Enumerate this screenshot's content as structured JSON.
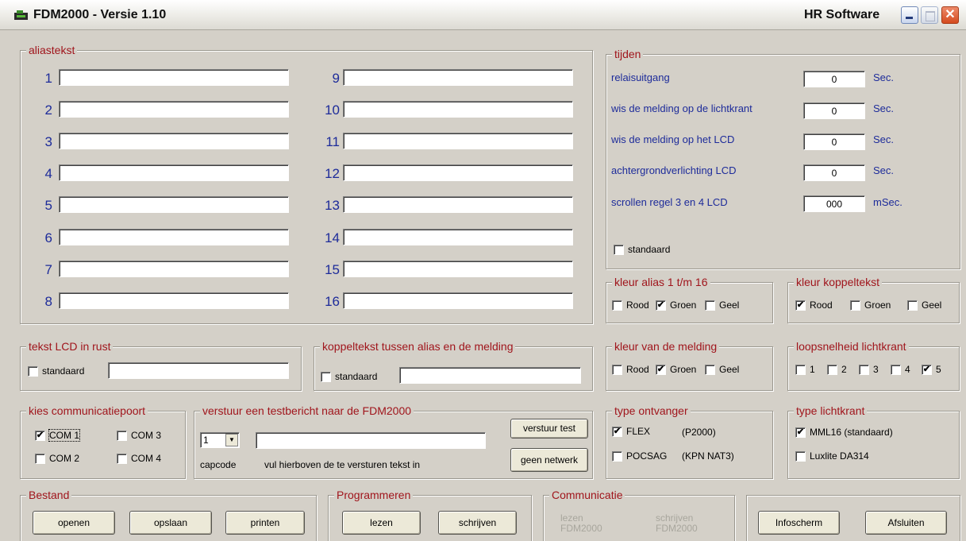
{
  "window": {
    "title": "FDM2000 - Versie 1.10",
    "company": "HR Software",
    "close_glyph": "✕",
    "icon": "fdm-app-icon"
  },
  "aliastekst": {
    "legend": "aliastekst",
    "numbers": [
      "1",
      "2",
      "3",
      "4",
      "5",
      "6",
      "7",
      "8",
      "9",
      "10",
      "11",
      "12",
      "13",
      "14",
      "15",
      "16"
    ],
    "values": [
      "",
      "",
      "",
      "",
      "",
      "",
      "",
      "",
      "",
      "",
      "",
      "",
      "",
      "",
      "",
      ""
    ]
  },
  "tijden": {
    "legend": "tijden",
    "rows": [
      {
        "label": "relaisuitgang",
        "value": "0",
        "unit": "Sec."
      },
      {
        "label": "wis de melding op de lichtkrant",
        "value": "0",
        "unit": "Sec."
      },
      {
        "label": "wis de melding op het LCD",
        "value": "0",
        "unit": "Sec."
      },
      {
        "label": "achtergrondverlichting LCD",
        "value": "0",
        "unit": "Sec."
      },
      {
        "label": "scrollen regel 3 en 4 LCD",
        "value": "000",
        "unit": "mSec."
      }
    ],
    "standaard": {
      "label": "standaard",
      "checked": false
    }
  },
  "kleur_alias": {
    "legend": "kleur alias 1 t/m 16",
    "options": [
      {
        "label": "Rood",
        "checked": false
      },
      {
        "label": "Groen",
        "checked": true
      },
      {
        "label": "Geel",
        "checked": false
      }
    ]
  },
  "kleur_koppeltekst": {
    "legend": "kleur koppeltekst",
    "options": [
      {
        "label": "Rood",
        "checked": true
      },
      {
        "label": "Groen",
        "checked": false
      },
      {
        "label": "Geel",
        "checked": false
      }
    ]
  },
  "tekst_lcd": {
    "legend": "tekst LCD in rust",
    "standaard": {
      "label": "standaard",
      "checked": false
    },
    "value": ""
  },
  "koppeltekst": {
    "legend": "koppeltekst tussen alias en de melding",
    "standaard": {
      "label": "standaard",
      "checked": false
    },
    "value": ""
  },
  "kleur_melding": {
    "legend": "kleur van de melding",
    "options": [
      {
        "label": "Rood",
        "checked": false
      },
      {
        "label": "Groen",
        "checked": true
      },
      {
        "label": "Geel",
        "checked": false
      }
    ]
  },
  "loopsnelheid": {
    "legend": "loopsnelheid lichtkrant",
    "options": [
      {
        "label": "1",
        "checked": false
      },
      {
        "label": "2",
        "checked": false
      },
      {
        "label": "3",
        "checked": false
      },
      {
        "label": "4",
        "checked": false
      },
      {
        "label": "5",
        "checked": true
      }
    ]
  },
  "communicatiepoort": {
    "legend": "kies communicatiepoort",
    "options": [
      {
        "label": "COM 1",
        "checked": true
      },
      {
        "label": "COM 3",
        "checked": false
      },
      {
        "label": "COM 2",
        "checked": false
      },
      {
        "label": "COM 4",
        "checked": false
      }
    ]
  },
  "testbericht": {
    "legend": "verstuur een testbericht naar de FDM2000",
    "capcode_value": "1",
    "capcode_label": "capcode",
    "message_value": "",
    "hint": "vul hierboven de te versturen tekst in",
    "send_button": "verstuur test",
    "network_button": "geen netwerk"
  },
  "ontvanger": {
    "legend": "type ontvanger",
    "options": [
      {
        "label": "FLEX",
        "note": "(P2000)",
        "checked": true
      },
      {
        "label": "POCSAG",
        "note": "(KPN NAT3)",
        "checked": false
      }
    ]
  },
  "lichtkrant": {
    "legend": "type lichtkrant",
    "options": [
      {
        "label": "MML16 (standaard)",
        "checked": true
      },
      {
        "label": "Luxlite DA314",
        "checked": false
      }
    ]
  },
  "bestand": {
    "legend": "Bestand",
    "buttons": [
      "openen",
      "opslaan",
      "printen"
    ]
  },
  "programmeren": {
    "legend": "Programmeren",
    "buttons": [
      "lezen",
      "schrijven"
    ]
  },
  "communicatie": {
    "legend": "Communicatie",
    "lezen": {
      "line1": "lezen",
      "line2": "FDM2000"
    },
    "schrijven": {
      "line1": "schrijven",
      "line2": "FDM2000"
    }
  },
  "actions": {
    "buttons": [
      "Infoscherm",
      "Afsluiten"
    ]
  }
}
